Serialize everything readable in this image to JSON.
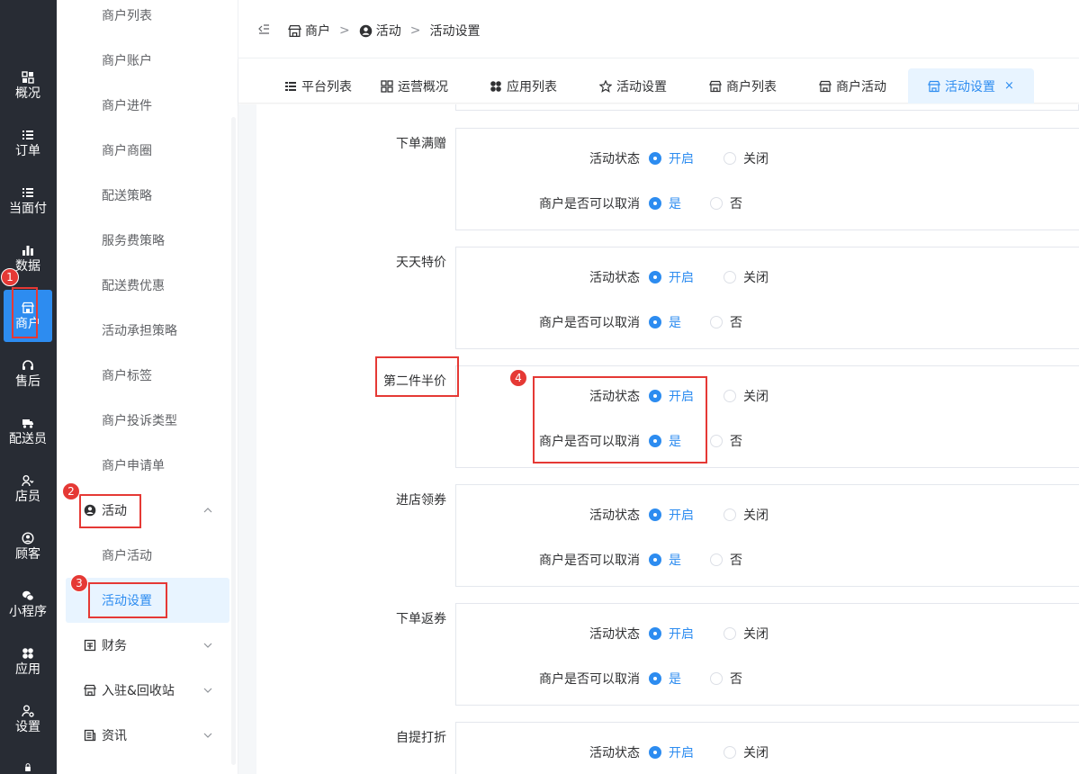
{
  "rail": [
    {
      "label": "概况",
      "icon": "grid-icon"
    },
    {
      "label": "订单",
      "icon": "list-icon"
    },
    {
      "label": "当面付",
      "icon": "list-icon"
    },
    {
      "label": "数据",
      "icon": "bar-chart-icon"
    },
    {
      "label": "商户",
      "icon": "store-icon",
      "active": true
    },
    {
      "label": "售后",
      "icon": "headset-icon"
    },
    {
      "label": "配送员",
      "icon": "delivery-icon"
    },
    {
      "label": "店员",
      "icon": "users-icon"
    },
    {
      "label": "顾客",
      "icon": "user-circle-icon"
    },
    {
      "label": "小程序",
      "icon": "wechat-icon"
    },
    {
      "label": "应用",
      "icon": "apps-icon"
    },
    {
      "label": "设置",
      "icon": "user-gear-icon"
    }
  ],
  "sidebar": {
    "items": [
      "商户列表",
      "商户账户",
      "商户进件",
      "商户商圈",
      "配送策略",
      "服务费策略",
      "配送费优惠",
      "活动承担策略",
      "商户标签",
      "商户投诉类型",
      "商户申请单"
    ],
    "group_activity": "活动",
    "activity_children": [
      "商户活动",
      "活动设置"
    ],
    "group_finance": "财务",
    "group_settle": "入驻&回收站",
    "group_news": "资讯"
  },
  "breadcrumb": {
    "items": [
      "商户",
      "活动",
      "活动设置"
    ],
    "sep": ">"
  },
  "tabs": [
    {
      "label": "平台列表",
      "icon": "list-icon"
    },
    {
      "label": "运营概况",
      "icon": "grid-icon"
    },
    {
      "label": "应用列表",
      "icon": "apps-icon"
    },
    {
      "label": "活动设置",
      "icon": "star-icon"
    },
    {
      "label": "商户列表",
      "icon": "store-icon"
    },
    {
      "label": "商户活动",
      "icon": "store-icon"
    },
    {
      "label": "活动设置",
      "icon": "store-icon",
      "active": true,
      "close": "×"
    }
  ],
  "settings": {
    "status_label": "活动状态",
    "cancel_label": "商户是否可以取消",
    "on": "开启",
    "off": "关闭",
    "yes": "是",
    "no": "否",
    "rows": [
      {
        "name": "下单满赠"
      },
      {
        "name": "天天特价"
      },
      {
        "name": "第二件半价"
      },
      {
        "name": "进店领券"
      },
      {
        "name": "下单返券"
      },
      {
        "name": "自提打折"
      }
    ]
  },
  "annotations": [
    "1",
    "2",
    "3",
    "4"
  ],
  "colors": {
    "accent": "#2d8cf0",
    "rail_bg": "#282c34",
    "annotation": "#e53935"
  }
}
